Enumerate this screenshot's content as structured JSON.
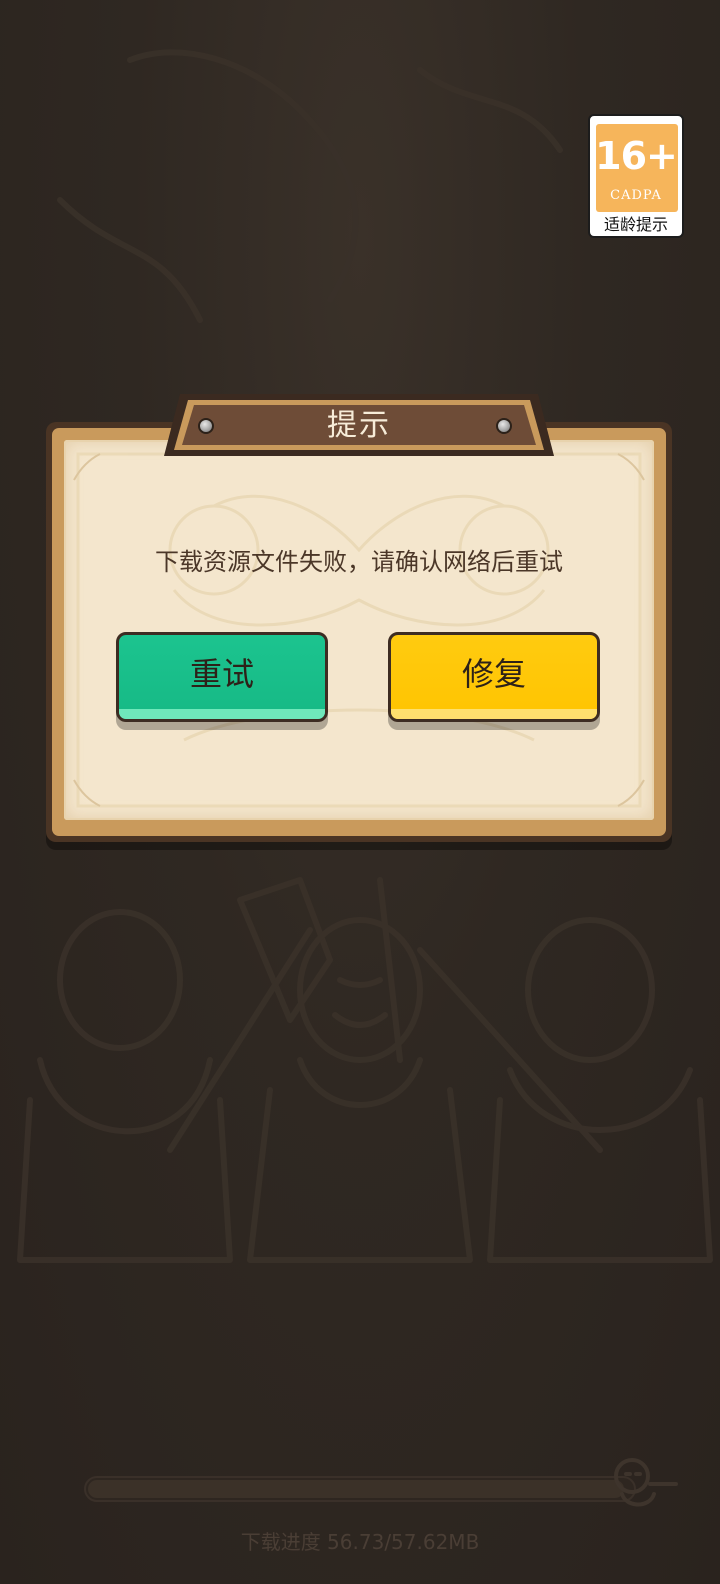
{
  "age_badge": {
    "age": "16+",
    "org": "CADPA",
    "caption": "适龄提示"
  },
  "dialog": {
    "title": "提示",
    "message": "下载资源文件失败，请确认网络后重试",
    "retry_label": "重试",
    "repair_label": "修复"
  },
  "loading": {
    "progress_text": "下载进度 56.73/57.62MB",
    "progress": 0.985
  },
  "colors": {
    "background": "#2b241f",
    "paper": "#f4e6cd",
    "frame": "#c99a5c",
    "retry_button": "#16b985",
    "repair_button": "#ffc400",
    "title_banner": "#6e4c37"
  }
}
